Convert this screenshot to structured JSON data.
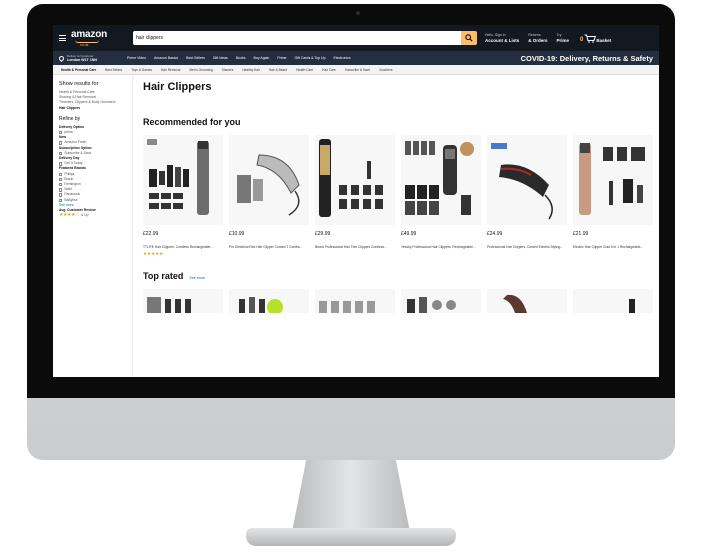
{
  "header": {
    "logo_text": "amazon",
    "logo_sub": ".co.uk",
    "search_value": "hair clippers",
    "nav": [
      {
        "line1": "Hello, Sign in",
        "line2": "Account & Lists"
      },
      {
        "line1": "Returns",
        "line2": "& Orders"
      },
      {
        "line1": "Try",
        "line2": "Prime"
      }
    ],
    "basket_count": "0",
    "basket_label": "Basket"
  },
  "subnav": {
    "deliver_line1": "Deliver to Customer",
    "deliver_line2": "London W1T 1NN",
    "links": [
      "Prime Video",
      "Amazon Basics",
      "Best Sellers",
      "Gift Ideas",
      "Books",
      "Buy Again",
      "Prime",
      "Gift Cards & Top Up",
      "Electronics"
    ],
    "covid": "COVID-19: Delivery, Returns & Safety"
  },
  "categories": [
    "Health & Personal Care",
    "Best Sellers",
    "Toys & Games",
    "Hair Removal",
    "Men's Grooming",
    "Shavers",
    "Healthy Hair",
    "Hair & Beard",
    "Health Care",
    "Hair Care",
    "Subscribe & Save",
    "Vouchers"
  ],
  "sidebar": {
    "show_results": "Show results for",
    "categories": [
      "Health & Personal Care",
      "Shaving & Hair Removal",
      "Trimmers, Clippers & Body Groomers"
    ],
    "selected": "Hair Clippers",
    "refine": "Refine by",
    "delivery_head": "Delivery Option",
    "delivery_value": "prime",
    "new_head": "New",
    "new_value": "Amazon Fresh",
    "subscribe_head": "Subscription Option",
    "subscribe_value": "Subscribe & Save",
    "delivery_day_head": "Delivery Day",
    "delivery_day_value": "Get It Today",
    "brands_head": "Featured Brands",
    "brands": [
      "Philips",
      "Braun",
      "Remington",
      "Wahl",
      "Panasonic",
      "BaByliss"
    ],
    "see_more": "See more",
    "review_head": "Avg. Customer Review",
    "review_stars": "★★★★☆",
    "review_up": "& Up"
  },
  "main": {
    "page_title": "Hair Clippers",
    "recommended_title": "Recommended for you",
    "products": [
      {
        "price": "£22.99",
        "name": "TTLIFE Hair Clippers, Cordless Rechargeable...",
        "stars": "★★★★★",
        "kind": "set"
      },
      {
        "price": "£10.99",
        "name": "Pro Electrical Red Hair Clipper Corded 7 Combs...",
        "stars": "",
        "kind": "corded"
      },
      {
        "price": "£29.99",
        "name": "Beard Professional Hair Trim Clippers Cordless...",
        "stars": "",
        "kind": "gold"
      },
      {
        "price": "£49.99",
        "name": "Yesoky Professional Hair Clippers, Rechargeable...",
        "stars": "",
        "kind": "kit"
      },
      {
        "price": "£24.99",
        "name": "Professional Hair Clippers, Corded Electric Styling...",
        "stars": "",
        "kind": "redcord"
      },
      {
        "price": "£21.99",
        "name": "Electric Hair Clipper Gold 5 in 1 Rechargeable...",
        "stars": "",
        "kind": "rose"
      }
    ],
    "toprated_title": "Top rated",
    "see_more": "See more"
  }
}
